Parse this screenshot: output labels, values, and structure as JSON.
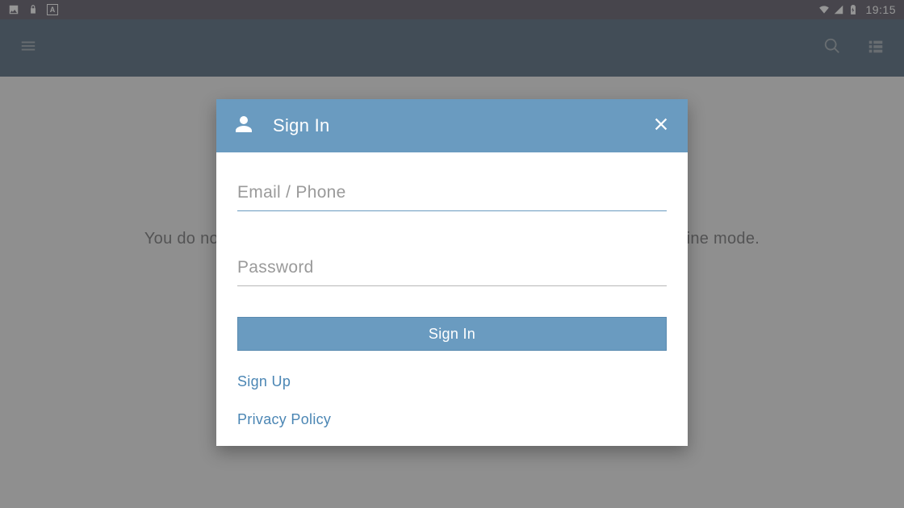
{
  "status": {
    "time": "19:15"
  },
  "main": {
    "offline_message": "You do not have any games in your local library. Please Sign In to exit offline mode."
  },
  "dialog": {
    "title": "Sign In",
    "email_placeholder": "Email / Phone",
    "email_value": "",
    "password_placeholder": "Password",
    "password_value": "",
    "signin_button": "Sign In",
    "signup_link": "Sign Up",
    "privacy_link": "Privacy Policy"
  },
  "colors": {
    "status_bar": "#3a3648",
    "app_bar": "#2e4a61",
    "accent": "#6a9bc0",
    "link": "#4b86b4",
    "background": "#eeeeee"
  }
}
